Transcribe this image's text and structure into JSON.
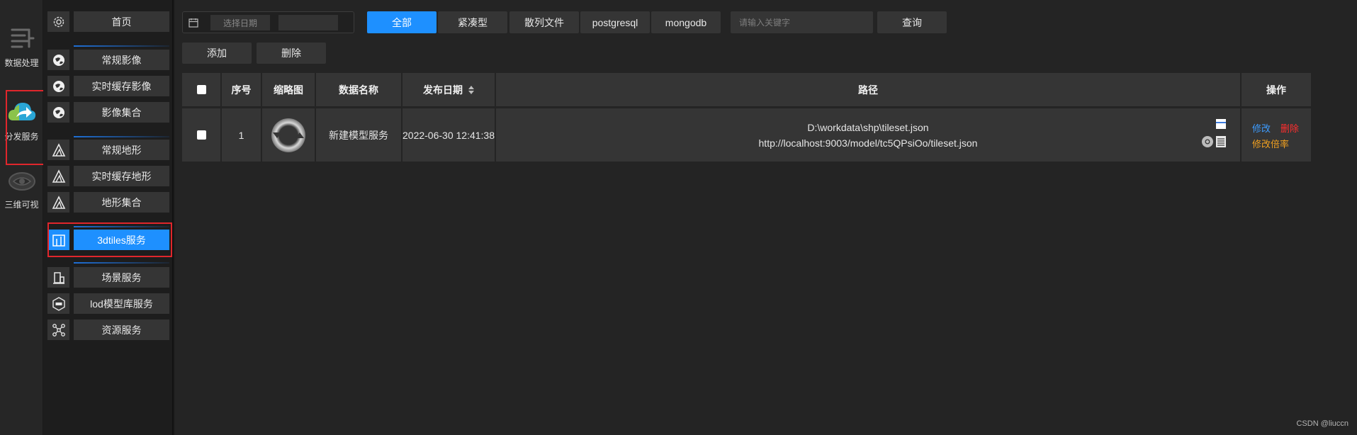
{
  "rail": {
    "items": [
      {
        "label": "数据处理",
        "icon": "data-process-icon"
      },
      {
        "label": "分发服务",
        "icon": "cloud-share-icon"
      },
      {
        "label": "三维可视",
        "icon": "3d-view-icon"
      }
    ]
  },
  "nav": {
    "items": [
      {
        "label": "首页",
        "icon": "settings-icon"
      },
      {
        "label": "常规影像",
        "icon": "globe-icon"
      },
      {
        "label": "实时缓存影像",
        "icon": "globe-icon"
      },
      {
        "label": "影像集合",
        "icon": "globe-icon"
      },
      {
        "label": "常规地形",
        "icon": "mountain-icon"
      },
      {
        "label": "实时缓存地形",
        "icon": "mountain-icon"
      },
      {
        "label": "地形集合",
        "icon": "mountain-icon"
      },
      {
        "label": "3dtiles服务",
        "icon": "buildings-icon"
      },
      {
        "label": "场景服务",
        "icon": "scene-icon"
      },
      {
        "label": "lod模型库服务",
        "icon": "lod-icon"
      },
      {
        "label": "资源服务",
        "icon": "network-icon"
      }
    ],
    "active_index": 7
  },
  "toolbar": {
    "date_placeholder": "选择日期",
    "filters": [
      "全部",
      "紧凑型",
      "散列文件",
      "postgresql",
      "mongodb"
    ],
    "active_filter": 0,
    "search_placeholder": "请输入关键字",
    "query_label": "查询",
    "add_label": "添加",
    "delete_label": "删除"
  },
  "table": {
    "columns": [
      "序号",
      "缩略图",
      "数据名称",
      "发布日期",
      "路径",
      "操作"
    ],
    "rows": [
      {
        "index": "1",
        "name": "新建模型服务",
        "date": "2022-06-30 12:41:38",
        "path_local": "D:\\workdata\\shp\\tileset.json",
        "path_url": "http://localhost:9003/model/tc5QPsiOo/tileset.json",
        "actions": {
          "edit": "修改",
          "delete": "删除",
          "edit_rate": "修改倍率"
        }
      }
    ]
  },
  "footer": {
    "text": "CSDN @liuccn"
  },
  "colors": {
    "accent": "#1e90ff",
    "danger": "#ff2e2e",
    "warning": "#f0a020",
    "link": "#3d9cff",
    "highlight_box": "#e0262c"
  }
}
